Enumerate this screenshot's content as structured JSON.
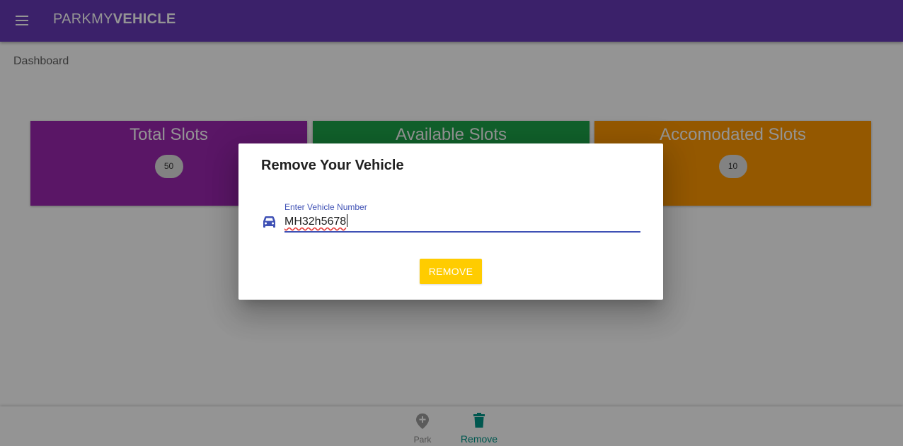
{
  "app": {
    "brand_light": "PARKMY",
    "brand_bold": "VEHICLE",
    "menu_icon": "menu-icon"
  },
  "page": {
    "label": "Dashboard"
  },
  "cards": [
    {
      "title": "Total Slots",
      "count": "50",
      "color": "#9c27b0"
    },
    {
      "title": "Available Slots",
      "count": "",
      "color": "#1ea64a"
    },
    {
      "title": "Accomodated Slots",
      "count": "10",
      "color": "#ff9800"
    }
  ],
  "dialog": {
    "title": "Remove Your Vehicle",
    "field_label": "Enter Vehicle Number",
    "field_value": "MH32h5678",
    "field_icon": "car-icon",
    "button_label": "REMOVE",
    "button_color": "#ffcc00"
  },
  "bottom_nav": {
    "items": [
      {
        "label": "Park",
        "icon": "map-marker-plus-icon",
        "active": false
      },
      {
        "label": "Remove",
        "icon": "trash-icon",
        "active": true
      }
    ]
  },
  "colors": {
    "appbar": "#673ab7",
    "accent": "#3f51b5",
    "active_nav": "#009688"
  }
}
